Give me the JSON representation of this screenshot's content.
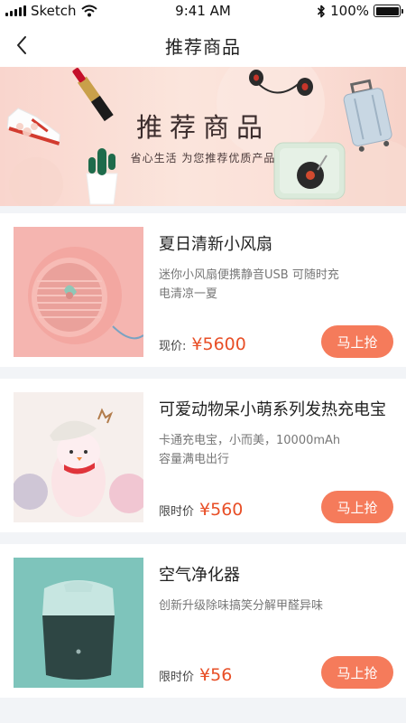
{
  "status_bar": {
    "carrier": "Sketch",
    "time": "9:41 AM",
    "battery": "100%"
  },
  "nav": {
    "title": "推荐商品",
    "back_icon": "chevron-left-icon"
  },
  "banner": {
    "title": "推荐商品",
    "subtitle": "省心生活 为您推荐优质产品"
  },
  "products": [
    {
      "name": "夏日清新小风扇",
      "desc": "迷你小风扇便携静音USB 可随时充电清凉一夏",
      "price_label": "现价:",
      "price": "¥5600",
      "button": "马上抢"
    },
    {
      "name": "可爱动物呆小萌系列发热充电宝",
      "desc": "卡通充电宝，小而美，10000mAh 容量满电出行",
      "price_label": "限时价",
      "price": "¥560",
      "button": "马上抢"
    },
    {
      "name": "空气净化器",
      "desc": "创新升级除味搞笑分解甲醛异味",
      "price_label": "限时价",
      "price": "¥56",
      "button": "马上抢"
    }
  ],
  "colors": {
    "accent": "#f57b5b",
    "price": "#e84f27"
  }
}
